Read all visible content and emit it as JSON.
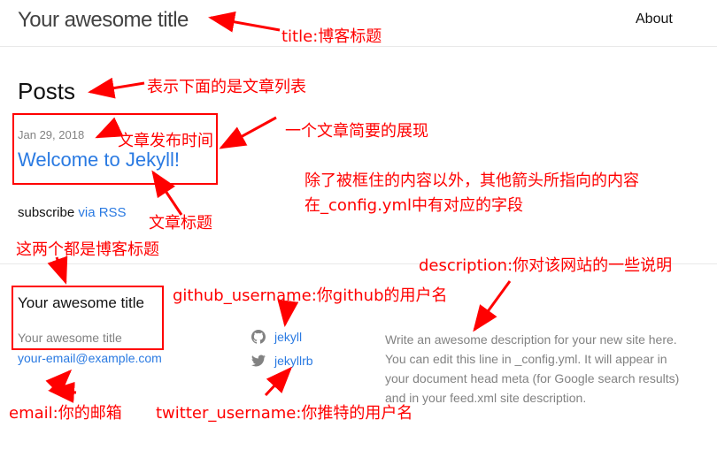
{
  "header": {
    "site_title": "Your awesome title",
    "nav_about": "About"
  },
  "main": {
    "heading": "Posts",
    "post": {
      "date": "Jan 29, 2018",
      "title": "Welcome to Jekyll!"
    },
    "subscribe_text": "subscribe",
    "subscribe_link": "via RSS"
  },
  "footer": {
    "title": "Your awesome title",
    "name": "Your awesome title",
    "email": "your-email@example.com",
    "github": {
      "icon": "github-icon",
      "username": "jekyll"
    },
    "twitter": {
      "icon": "twitter-icon",
      "username": "jekyllrb"
    },
    "description": "Write an awesome description for your new site here. You can edit this line in _config.yml. It will appear in your document head meta (for Google search results) and in your feed.xml site description."
  },
  "annotations": {
    "title": "title:博客标题",
    "posts_list": "表示下面的是文章列表",
    "post_summary": "一个文章简要的展现",
    "post_date": "文章发布时间",
    "config_note_1": "除了被框住的内容以外，其他箭头所指向的内容",
    "config_note_2": "在_config.yml中有对应的字段",
    "post_title": "文章标题",
    "both_title": "这两个都是博客标题",
    "description": "description:你对该网站的一些说明",
    "github": "github_username:你github的用户名",
    "email": "email:你的邮箱",
    "twitter": "twitter_username:你推特的用户名"
  },
  "colors": {
    "accent": "#2a7ae2",
    "annotation": "#ff0000",
    "muted": "#828282"
  }
}
